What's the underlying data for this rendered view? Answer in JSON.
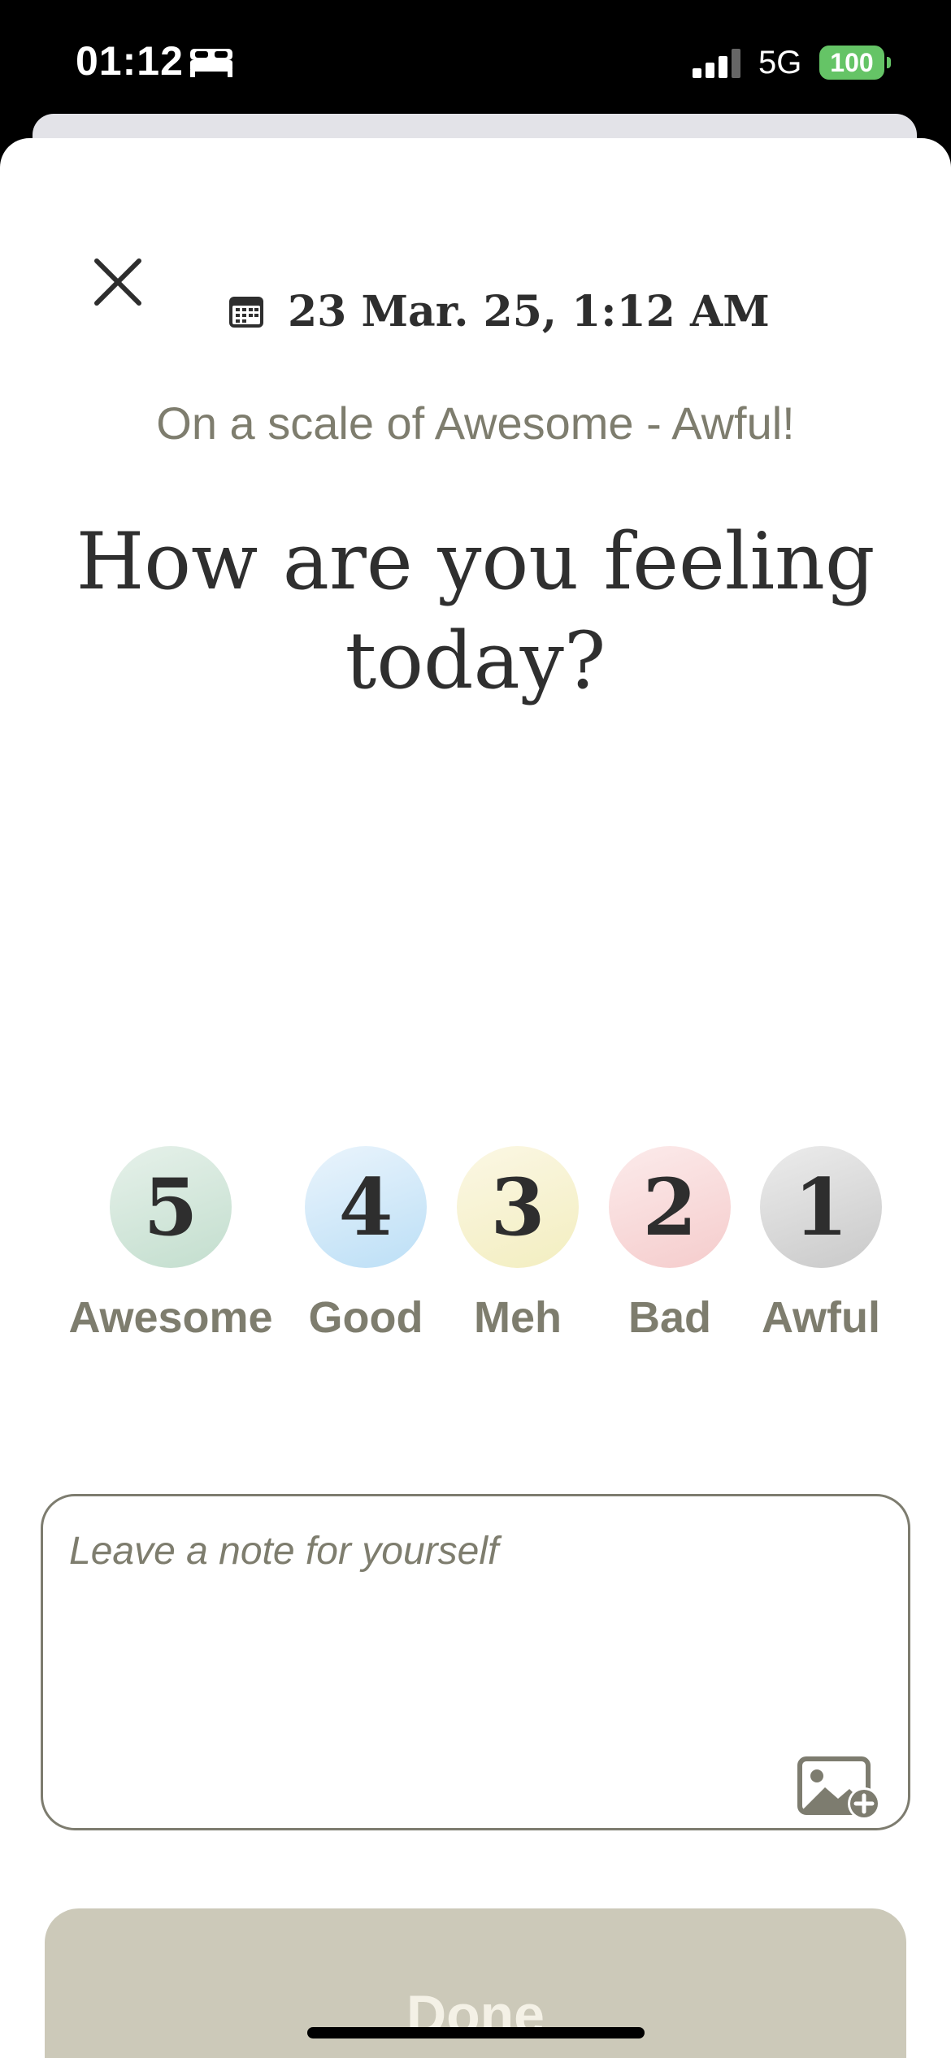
{
  "status_bar": {
    "time": "01:12",
    "network": "5G",
    "battery": "100",
    "icons": [
      "bed-icon",
      "signal-icon"
    ]
  },
  "header": {
    "close_icon": "close-icon",
    "date_icon": "calendar-icon",
    "date": "23 Mar. 25, 1:12 AM"
  },
  "prompt": {
    "subtitle": "On a scale of Awesome - Awful!",
    "headline": "How are you feeling today?"
  },
  "moods": [
    {
      "value": "5",
      "label": "Awesome",
      "color_top": "#e6f1ea",
      "color_bottom": "#c3dece"
    },
    {
      "value": "4",
      "label": "Good",
      "color_top": "#eaf4fc",
      "color_bottom": "#bcdff6"
    },
    {
      "value": "3",
      "label": "Meh",
      "color_top": "#fbf7e4",
      "color_bottom": "#f3eec0"
    },
    {
      "value": "2",
      "label": "Bad",
      "color_top": "#fcebeb",
      "color_bottom": "#f5cccc"
    },
    {
      "value": "1",
      "label": "Awful",
      "color_top": "#ececec",
      "color_bottom": "#c9c9c9"
    }
  ],
  "note": {
    "placeholder": "Leave a note for yourself",
    "add_image_icon": "add-image-icon"
  },
  "done_button": {
    "label": "Done",
    "color": "#ccc9b9"
  }
}
